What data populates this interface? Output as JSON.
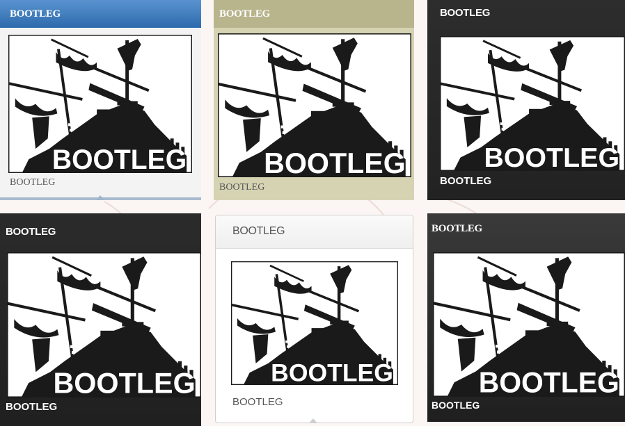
{
  "tiles": [
    {
      "header": "BOOTLEG",
      "artwork_text": "BOOTLEG",
      "caption": "BOOTLEG",
      "style": "blue"
    },
    {
      "header": "BOOTLEG",
      "artwork_text": "BOOTLEG",
      "caption": "BOOTLEG",
      "style": "khaki"
    },
    {
      "header": "BOOTLEG",
      "artwork_text": "BOOTLEG",
      "caption": "BOOTLEG",
      "style": "dark"
    },
    {
      "header": "BOOTLEG",
      "artwork_text": "BOOTLEG",
      "caption": "BOOTLEG",
      "style": "dark"
    },
    {
      "header": "BOOTLEG",
      "artwork_text": "BOOTLEG",
      "caption": "BOOTLEG",
      "style": "light-card"
    },
    {
      "header": "BOOTLEG",
      "artwork_text": "BOOTLEG",
      "caption": "BOOTLEG",
      "style": "dark-gradient"
    }
  ],
  "colors": {
    "blue_header": "#2d6aad",
    "khaki_body": "#d6d3b3",
    "dark_body": "#222222",
    "page_bg": "#fbf6f4"
  }
}
